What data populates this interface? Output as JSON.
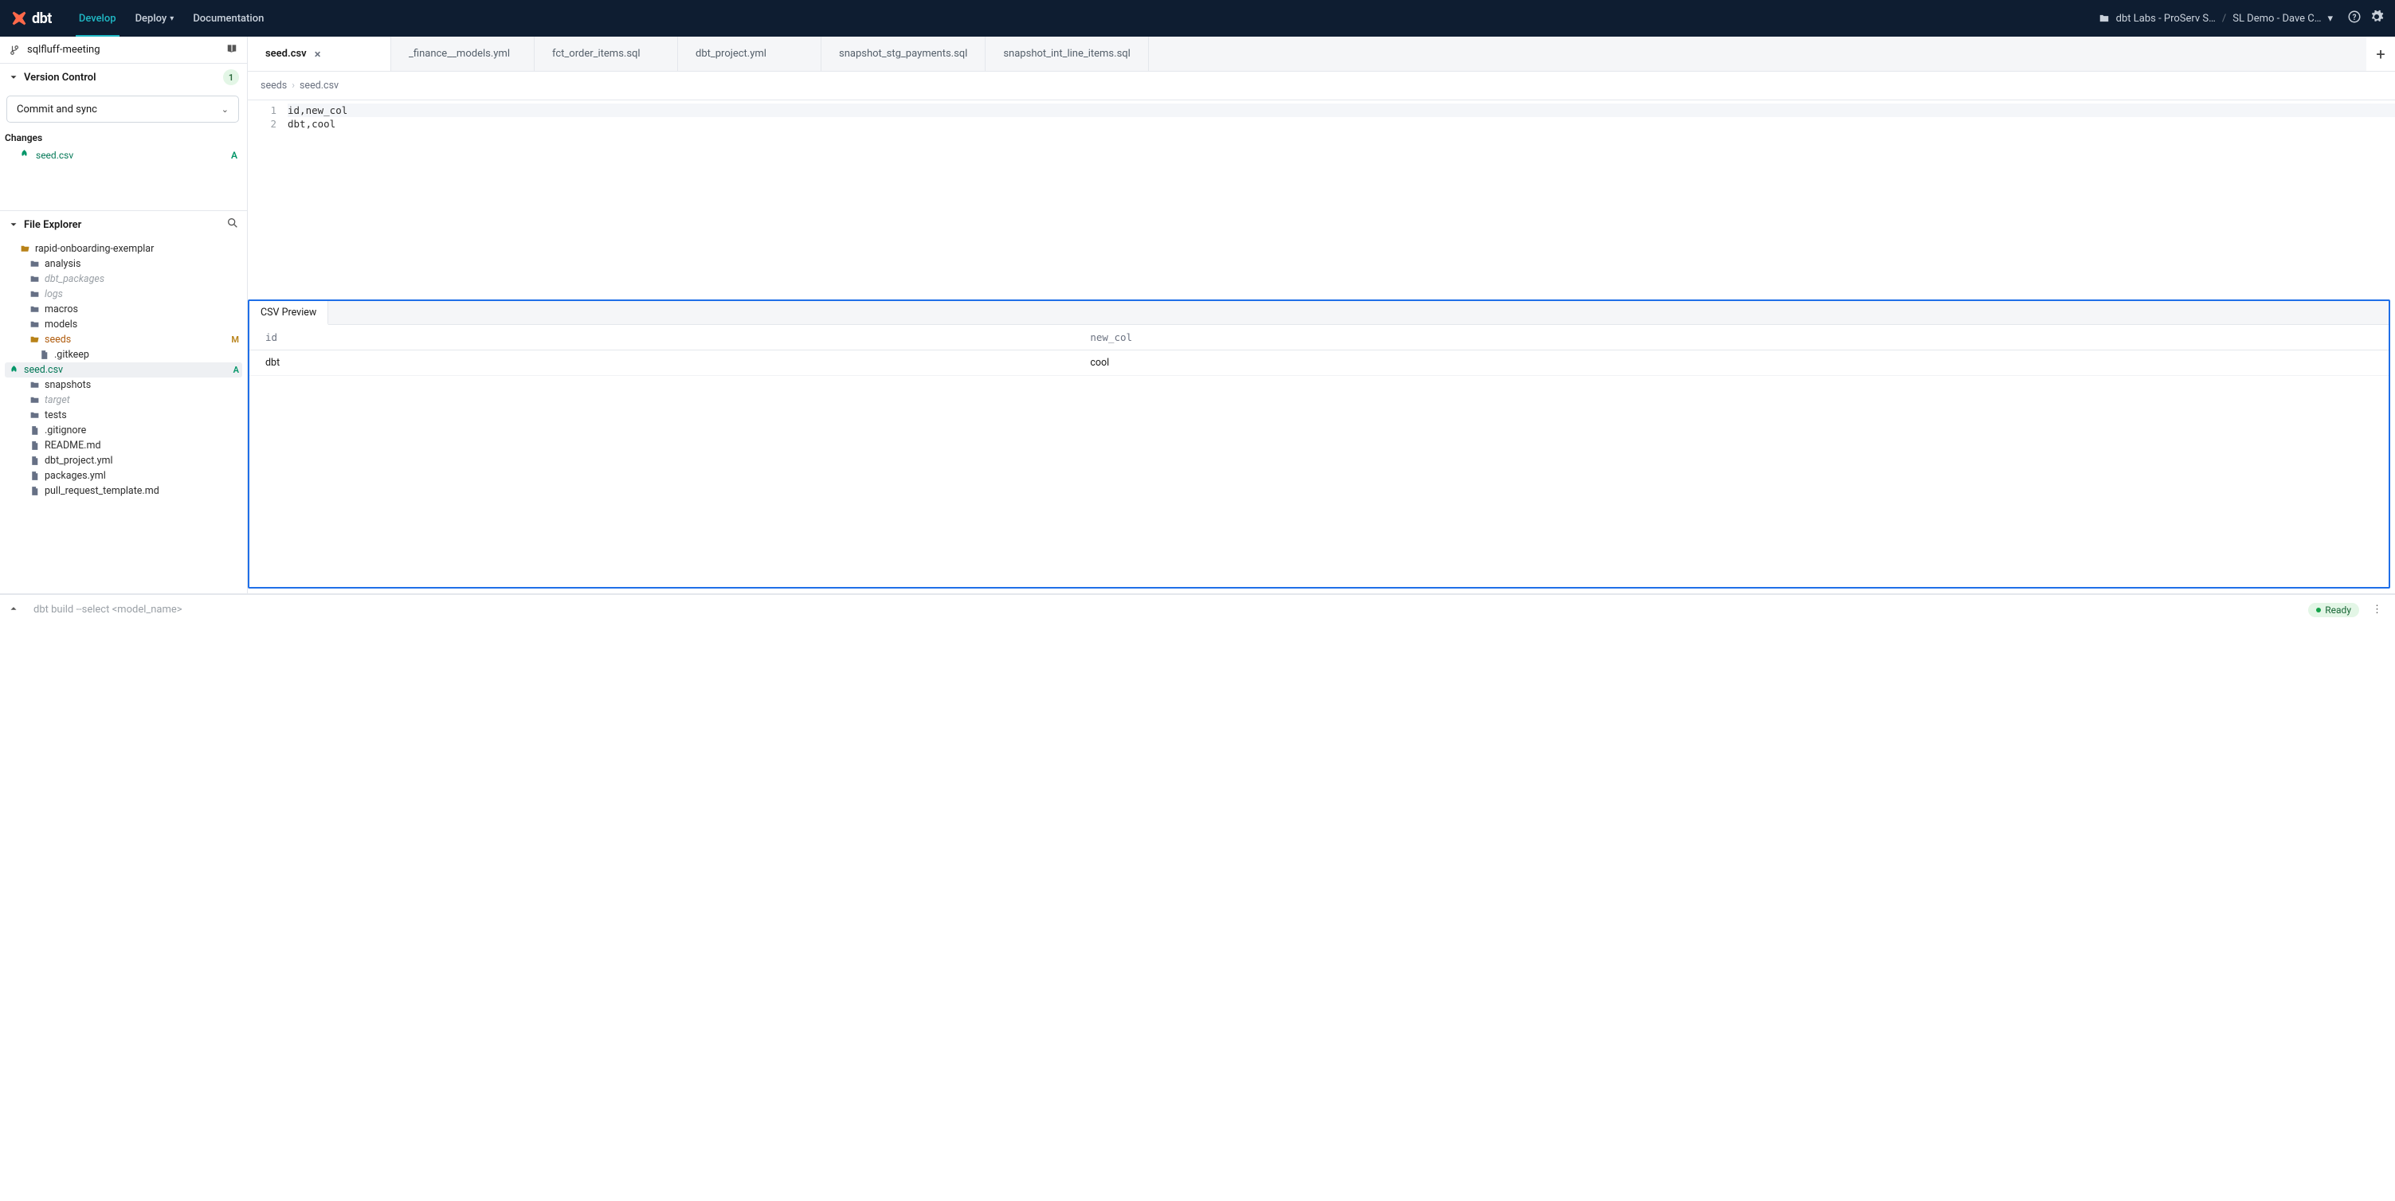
{
  "nav": {
    "develop": "Develop",
    "deploy": "Deploy",
    "documentation": "Documentation",
    "org": "dbt Labs - ProServ S…",
    "project": "SL Demo - Dave C…"
  },
  "branch": {
    "name": "sqlfluff-meeting"
  },
  "version_control": {
    "title": "Version Control",
    "count": "1",
    "commit_label": "Commit and sync",
    "changes_label": "Changes",
    "changes": [
      {
        "file": "seed.csv",
        "status": "A"
      }
    ]
  },
  "file_explorer": {
    "title": "File Explorer",
    "tree": [
      {
        "name": "rapid-onboarding-exemplar",
        "indent": 1,
        "type": "folder-open"
      },
      {
        "name": "analysis",
        "indent": 2,
        "type": "folder"
      },
      {
        "name": "dbt_packages",
        "indent": 2,
        "type": "folder",
        "dim": true
      },
      {
        "name": "logs",
        "indent": 2,
        "type": "folder",
        "dim": true
      },
      {
        "name": "macros",
        "indent": 2,
        "type": "folder"
      },
      {
        "name": "models",
        "indent": 2,
        "type": "folder"
      },
      {
        "name": "seeds",
        "indent": 2,
        "type": "folder-open",
        "status": "M",
        "seeds": true
      },
      {
        "name": ".gitkeep",
        "indent": 3,
        "type": "file"
      },
      {
        "name": "seed.csv",
        "indent": 3,
        "type": "seed",
        "status": "A",
        "selected": true
      },
      {
        "name": "snapshots",
        "indent": 2,
        "type": "folder"
      },
      {
        "name": "target",
        "indent": 2,
        "type": "folder",
        "dim": true
      },
      {
        "name": "tests",
        "indent": 2,
        "type": "folder"
      },
      {
        "name": ".gitignore",
        "indent": 2,
        "type": "file"
      },
      {
        "name": "README.md",
        "indent": 2,
        "type": "file"
      },
      {
        "name": "dbt_project.yml",
        "indent": 2,
        "type": "file"
      },
      {
        "name": "packages.yml",
        "indent": 2,
        "type": "file"
      },
      {
        "name": "pull_request_template.md",
        "indent": 2,
        "type": "file"
      }
    ]
  },
  "tabs": [
    {
      "label": "seed.csv",
      "active": true,
      "closeable": true
    },
    {
      "label": "_finance__models.yml"
    },
    {
      "label": "fct_order_items.sql"
    },
    {
      "label": "dbt_project.yml"
    },
    {
      "label": "snapshot_stg_payments.sql"
    },
    {
      "label": "snapshot_int_line_items.sql"
    }
  ],
  "breadcrumbs": {
    "parent": "seeds",
    "file": "seed.csv"
  },
  "editor": {
    "lines": [
      {
        "n": "1",
        "text": "id,new_col"
      },
      {
        "n": "2",
        "text": "dbt,cool"
      }
    ]
  },
  "preview": {
    "tab_label": "CSV Preview",
    "headers": [
      "id",
      "new_col"
    ],
    "rows": [
      [
        "dbt",
        "cool"
      ]
    ]
  },
  "footer": {
    "cmd_placeholder": "dbt build --select <model_name>",
    "ready": "Ready"
  }
}
